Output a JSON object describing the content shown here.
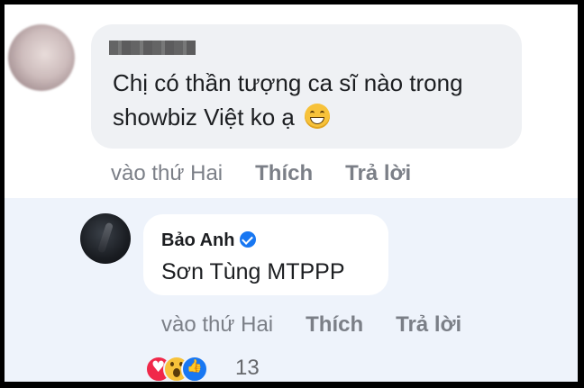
{
  "comment": {
    "text": "Chị có thần tượng ca sĩ nào trong showbiz Việt ko ạ",
    "emoji": "grinning-face-emoji",
    "time": "vào thứ Hai",
    "like_label": "Thích",
    "reply_label": "Trả lời"
  },
  "reply": {
    "author": "Bảo Anh",
    "verified": true,
    "text": "Sơn Tùng MTPPP",
    "time": "vào thứ Hai",
    "like_label": "Thích",
    "reply_label": "Trả lời",
    "reactions": [
      "heart-reaction",
      "wow-reaction",
      "like-reaction"
    ],
    "reaction_count": "13"
  },
  "colors": {
    "reply_background": "#eef3fb",
    "bubble": "#eff1f4",
    "meta_text": "#7b7f87",
    "verified_blue": "#1877f2"
  }
}
